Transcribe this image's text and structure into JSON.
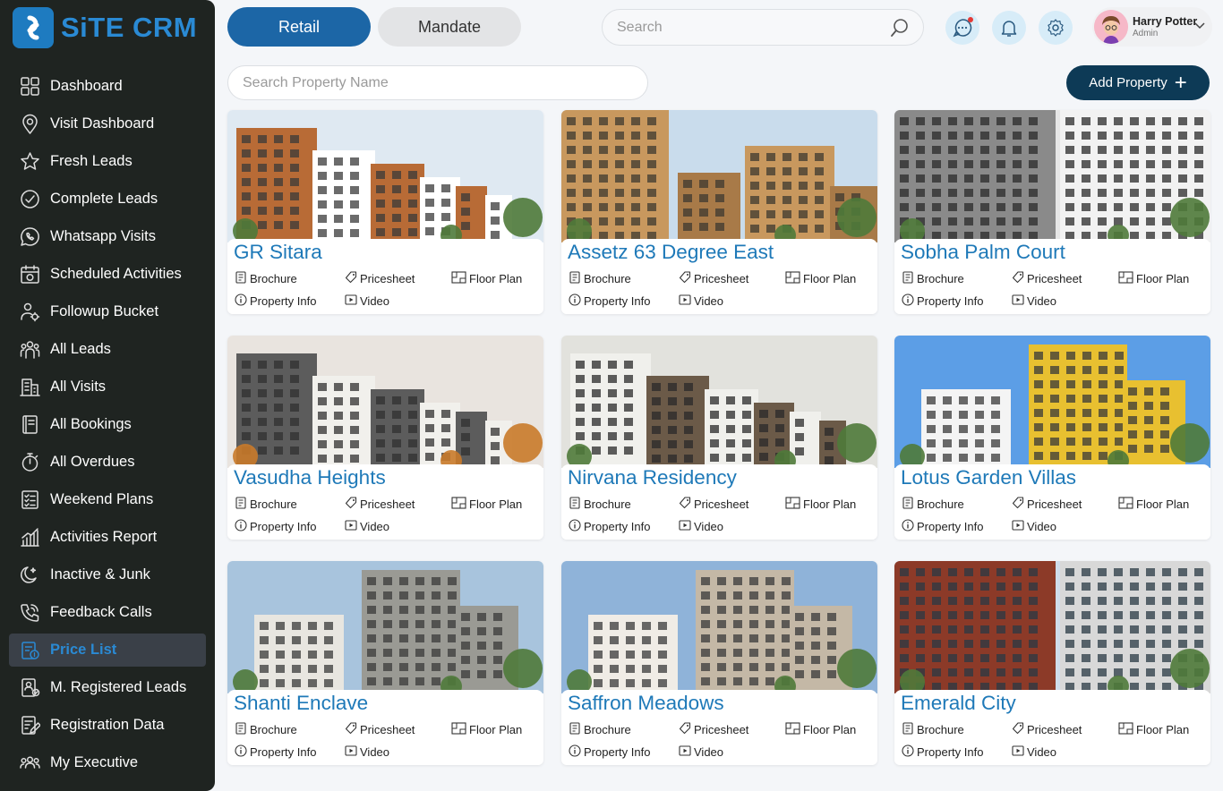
{
  "app": {
    "name": "SiTE CRM",
    "accent": "#1e7bc0",
    "sidebar_bg": "#1f2421"
  },
  "sidebar": {
    "items": [
      {
        "label": "Dashboard",
        "icon": "grid-icon"
      },
      {
        "label": "Visit Dashboard",
        "icon": "location-icon"
      },
      {
        "label": "Fresh Leads",
        "icon": "star-icon"
      },
      {
        "label": "Complete Leads",
        "icon": "check-circle-icon"
      },
      {
        "label": "Whatsapp Visits",
        "icon": "whatsapp-icon"
      },
      {
        "label": "Scheduled Activities",
        "icon": "calendar-icon"
      },
      {
        "label": "Followup Bucket",
        "icon": "person-settings-icon"
      },
      {
        "label": "All Leads",
        "icon": "group-icon"
      },
      {
        "label": "All Visits",
        "icon": "building-icon"
      },
      {
        "label": "All Bookings",
        "icon": "book-icon"
      },
      {
        "label": "All Overdues",
        "icon": "timer-icon"
      },
      {
        "label": "Weekend Plans",
        "icon": "checklist-icon"
      },
      {
        "label": "Activities Report",
        "icon": "bar-chart-icon"
      },
      {
        "label": "Inactive & Junk",
        "icon": "moon-icon"
      },
      {
        "label": "Feedback Calls",
        "icon": "phone-icon"
      },
      {
        "label": "Price List",
        "icon": "price-list-icon",
        "active": true
      },
      {
        "label": "M. Registered Leads",
        "icon": "register-icon"
      },
      {
        "label": "Registration Data",
        "icon": "edit-doc-icon"
      },
      {
        "label": "My Executive",
        "icon": "team-icon"
      }
    ]
  },
  "header": {
    "tabs": [
      {
        "label": "Retail",
        "active": true
      },
      {
        "label": "Mandate",
        "active": false
      }
    ],
    "search_placeholder": "Search",
    "user": {
      "name": "Harry Potter",
      "role": "Admin"
    }
  },
  "toolbar": {
    "property_search_placeholder": "Search Property Name",
    "add_property_label": "Add Property"
  },
  "card_actions": {
    "brochure": "Brochure",
    "pricesheet": "Pricesheet",
    "floor_plan": "Floor Plan",
    "property_info": "Property Info",
    "video": "Video"
  },
  "properties": [
    {
      "name": "GR Sitara",
      "sky": "#dfe9f2"
    },
    {
      "name": "Assetz 63 Degree East",
      "sky": "#c9dcec"
    },
    {
      "name": "Sobha Palm Court",
      "sky": "#e6e6e6"
    },
    {
      "name": "Vasudha Heights",
      "sky": "#e9e4df"
    },
    {
      "name": "Nirvana Residency",
      "sky": "#e2e2dd"
    },
    {
      "name": "Lotus Garden Villas",
      "sky": "#5c9ee6"
    },
    {
      "name": "Shanti Enclave",
      "sky": "#a8c4dd"
    },
    {
      "name": "Saffron Meadows",
      "sky": "#8fb3d9"
    },
    {
      "name": "Emerald City",
      "sky": "#cfdceb"
    }
  ]
}
